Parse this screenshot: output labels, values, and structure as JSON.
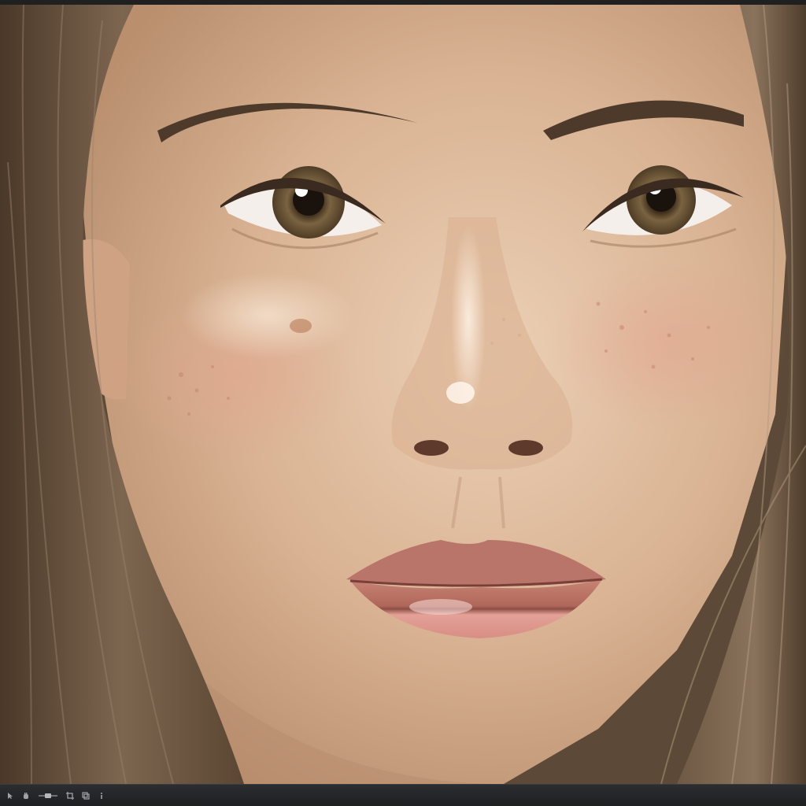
{
  "colors": {
    "window_frame": "#202020",
    "bottom_bar": "#1e1f21",
    "skin": "#d9b393",
    "hair": "#6b5440",
    "iris": "#6b5533",
    "lips": "#d9968a"
  },
  "bottom_bar": {
    "tools": [
      {
        "icon": "pointer-icon"
      },
      {
        "icon": "hand-icon"
      },
      {
        "icon": "zoom-slider-icon"
      },
      {
        "icon": "crop-icon"
      },
      {
        "icon": "layers-icon"
      },
      {
        "icon": "info-icon"
      }
    ]
  }
}
